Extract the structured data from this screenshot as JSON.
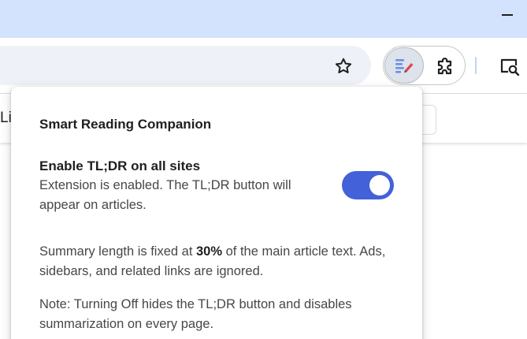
{
  "popup": {
    "title": "Smart Reading Companion",
    "setting": {
      "title": "Enable TL;DR on all sites",
      "description": "Extension is enabled. The TL;DR button will appear on articles.",
      "toggle_on": true
    },
    "summary": {
      "prefix": "Summary length is fixed at ",
      "percent": "30%",
      "suffix": " of the main article text. Ads, sidebars, and related links are ignored."
    },
    "note": "Note: Turning Off hides the TL;DR button and disables summarization on every page."
  },
  "page": {
    "fragment": "Li"
  },
  "toolbar": {
    "icons": [
      "bookmark-star-icon",
      "tldr-extension-icon",
      "extensions-puzzle-icon",
      "lens-search-icon"
    ]
  },
  "colors": {
    "titlebar": "#d3e3fd",
    "toggle_on": "#4361d8",
    "omnibox": "#eef2f8"
  }
}
